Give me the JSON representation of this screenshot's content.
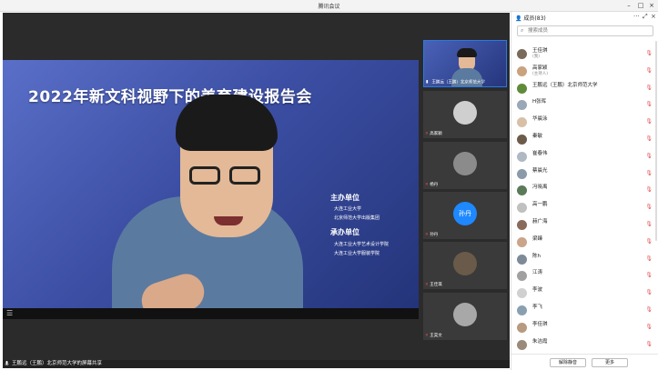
{
  "window": {
    "title": "腾讯会议",
    "minimize": "–",
    "maximize": "□",
    "close": "×"
  },
  "main_video": {
    "banner_title": "2022年新文科视野下的美育建设报告会",
    "organizer_label": "主办单位",
    "organizers": [
      "大连工业大学",
      "北京师范大学出版集团"
    ],
    "co_organizer_label": "承办单位",
    "co_organizers": [
      "大连工业大学艺术设计学院",
      "大连工业大学服装学院"
    ]
  },
  "bottom_bar": {
    "speaker_label": "王鹏远（王鹏）北京师范大学的屏幕共享"
  },
  "thumbnails": [
    {
      "label": "王鹏远（王鹏）北京师范大学"
    },
    {
      "label": "高家颖"
    },
    {
      "label": "杨丹"
    },
    {
      "label": "孙丹",
      "avatar_text": "孙丹"
    },
    {
      "label": "王佳琪"
    },
    {
      "label": "王昊文"
    }
  ],
  "panel": {
    "title": "成员(83)",
    "more": "···",
    "expand": "⤢",
    "close": "×",
    "search_placeholder": "搜索成员",
    "members": [
      {
        "name": "王佳琪",
        "sub": "(我)"
      },
      {
        "name": "高家颖",
        "sub": "(主持人)"
      },
      {
        "name": "王鹏远（王鹏）北京师范大学",
        "sub": ""
      },
      {
        "name": "H张晖",
        "sub": ""
      },
      {
        "name": "华晨泳",
        "sub": ""
      },
      {
        "name": "秦敏",
        "sub": ""
      },
      {
        "name": "崔春伟",
        "sub": ""
      },
      {
        "name": "蔡晨光",
        "sub": ""
      },
      {
        "name": "冯晓禹",
        "sub": ""
      },
      {
        "name": "高一鹏",
        "sub": ""
      },
      {
        "name": "赫广海",
        "sub": ""
      },
      {
        "name": "梁臻",
        "sub": ""
      },
      {
        "name": "陈h",
        "sub": ""
      },
      {
        "name": "江涛",
        "sub": ""
      },
      {
        "name": "李波",
        "sub": ""
      },
      {
        "name": "李飞",
        "sub": ""
      },
      {
        "name": "李佳琪",
        "sub": ""
      },
      {
        "name": "朱洁霞",
        "sub": ""
      }
    ],
    "unmute_all": "解除静音",
    "more_button": "更多"
  },
  "colors": {
    "accent": "#2a7ae2",
    "muted_mic": "#e05050",
    "banner": "#3f54a6"
  }
}
